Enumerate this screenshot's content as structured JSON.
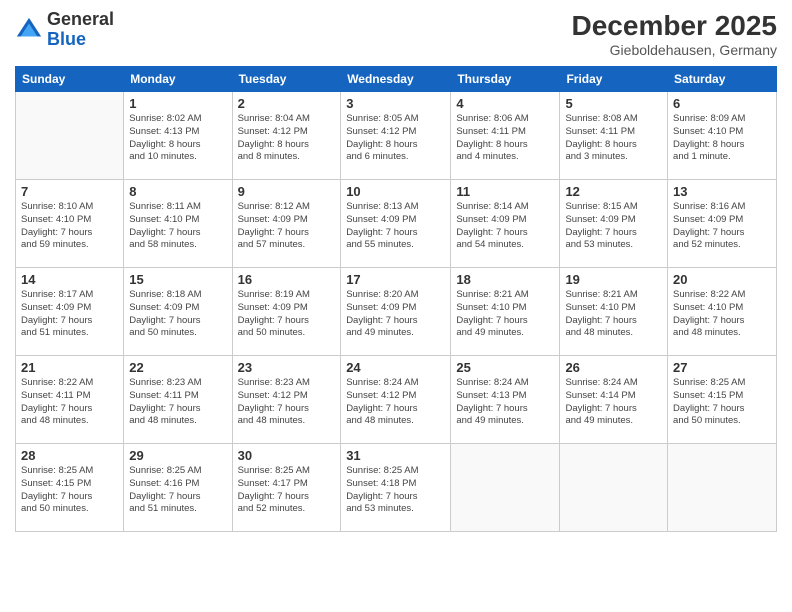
{
  "header": {
    "logo_general": "General",
    "logo_blue": "Blue",
    "month_title": "December 2025",
    "location": "Gieboldehausen, Germany"
  },
  "calendar": {
    "days_of_week": [
      "Sunday",
      "Monday",
      "Tuesday",
      "Wednesday",
      "Thursday",
      "Friday",
      "Saturday"
    ],
    "weeks": [
      [
        {
          "day": "",
          "info": ""
        },
        {
          "day": "1",
          "info": "Sunrise: 8:02 AM\nSunset: 4:13 PM\nDaylight: 8 hours\nand 10 minutes."
        },
        {
          "day": "2",
          "info": "Sunrise: 8:04 AM\nSunset: 4:12 PM\nDaylight: 8 hours\nand 8 minutes."
        },
        {
          "day": "3",
          "info": "Sunrise: 8:05 AM\nSunset: 4:12 PM\nDaylight: 8 hours\nand 6 minutes."
        },
        {
          "day": "4",
          "info": "Sunrise: 8:06 AM\nSunset: 4:11 PM\nDaylight: 8 hours\nand 4 minutes."
        },
        {
          "day": "5",
          "info": "Sunrise: 8:08 AM\nSunset: 4:11 PM\nDaylight: 8 hours\nand 3 minutes."
        },
        {
          "day": "6",
          "info": "Sunrise: 8:09 AM\nSunset: 4:10 PM\nDaylight: 8 hours\nand 1 minute."
        }
      ],
      [
        {
          "day": "7",
          "info": "Sunrise: 8:10 AM\nSunset: 4:10 PM\nDaylight: 7 hours\nand 59 minutes."
        },
        {
          "day": "8",
          "info": "Sunrise: 8:11 AM\nSunset: 4:10 PM\nDaylight: 7 hours\nand 58 minutes."
        },
        {
          "day": "9",
          "info": "Sunrise: 8:12 AM\nSunset: 4:09 PM\nDaylight: 7 hours\nand 57 minutes."
        },
        {
          "day": "10",
          "info": "Sunrise: 8:13 AM\nSunset: 4:09 PM\nDaylight: 7 hours\nand 55 minutes."
        },
        {
          "day": "11",
          "info": "Sunrise: 8:14 AM\nSunset: 4:09 PM\nDaylight: 7 hours\nand 54 minutes."
        },
        {
          "day": "12",
          "info": "Sunrise: 8:15 AM\nSunset: 4:09 PM\nDaylight: 7 hours\nand 53 minutes."
        },
        {
          "day": "13",
          "info": "Sunrise: 8:16 AM\nSunset: 4:09 PM\nDaylight: 7 hours\nand 52 minutes."
        }
      ],
      [
        {
          "day": "14",
          "info": "Sunrise: 8:17 AM\nSunset: 4:09 PM\nDaylight: 7 hours\nand 51 minutes."
        },
        {
          "day": "15",
          "info": "Sunrise: 8:18 AM\nSunset: 4:09 PM\nDaylight: 7 hours\nand 50 minutes."
        },
        {
          "day": "16",
          "info": "Sunrise: 8:19 AM\nSunset: 4:09 PM\nDaylight: 7 hours\nand 50 minutes."
        },
        {
          "day": "17",
          "info": "Sunrise: 8:20 AM\nSunset: 4:09 PM\nDaylight: 7 hours\nand 49 minutes."
        },
        {
          "day": "18",
          "info": "Sunrise: 8:21 AM\nSunset: 4:10 PM\nDaylight: 7 hours\nand 49 minutes."
        },
        {
          "day": "19",
          "info": "Sunrise: 8:21 AM\nSunset: 4:10 PM\nDaylight: 7 hours\nand 48 minutes."
        },
        {
          "day": "20",
          "info": "Sunrise: 8:22 AM\nSunset: 4:10 PM\nDaylight: 7 hours\nand 48 minutes."
        }
      ],
      [
        {
          "day": "21",
          "info": "Sunrise: 8:22 AM\nSunset: 4:11 PM\nDaylight: 7 hours\nand 48 minutes."
        },
        {
          "day": "22",
          "info": "Sunrise: 8:23 AM\nSunset: 4:11 PM\nDaylight: 7 hours\nand 48 minutes."
        },
        {
          "day": "23",
          "info": "Sunrise: 8:23 AM\nSunset: 4:12 PM\nDaylight: 7 hours\nand 48 minutes."
        },
        {
          "day": "24",
          "info": "Sunrise: 8:24 AM\nSunset: 4:12 PM\nDaylight: 7 hours\nand 48 minutes."
        },
        {
          "day": "25",
          "info": "Sunrise: 8:24 AM\nSunset: 4:13 PM\nDaylight: 7 hours\nand 49 minutes."
        },
        {
          "day": "26",
          "info": "Sunrise: 8:24 AM\nSunset: 4:14 PM\nDaylight: 7 hours\nand 49 minutes."
        },
        {
          "day": "27",
          "info": "Sunrise: 8:25 AM\nSunset: 4:15 PM\nDaylight: 7 hours\nand 50 minutes."
        }
      ],
      [
        {
          "day": "28",
          "info": "Sunrise: 8:25 AM\nSunset: 4:15 PM\nDaylight: 7 hours\nand 50 minutes."
        },
        {
          "day": "29",
          "info": "Sunrise: 8:25 AM\nSunset: 4:16 PM\nDaylight: 7 hours\nand 51 minutes."
        },
        {
          "day": "30",
          "info": "Sunrise: 8:25 AM\nSunset: 4:17 PM\nDaylight: 7 hours\nand 52 minutes."
        },
        {
          "day": "31",
          "info": "Sunrise: 8:25 AM\nSunset: 4:18 PM\nDaylight: 7 hours\nand 53 minutes."
        },
        {
          "day": "",
          "info": ""
        },
        {
          "day": "",
          "info": ""
        },
        {
          "day": "",
          "info": ""
        }
      ]
    ]
  }
}
